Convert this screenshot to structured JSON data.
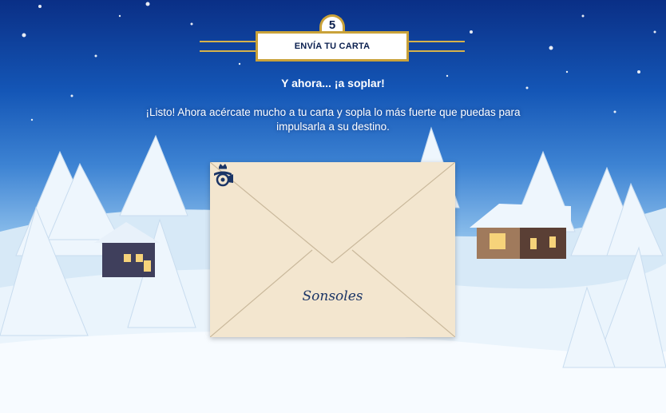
{
  "step": {
    "number": "5",
    "title": "ENVÍA TU CARTA"
  },
  "content": {
    "subtitle": "Y ahora... ¡a soplar!",
    "instructions": "¡Listo! Ahora acércate mucho a tu carta y sopla lo más fuerte que puedas para impulsarla a su destino."
  },
  "envelope": {
    "recipient": "Sonsoles",
    "logo": "correos-horn-icon"
  },
  "colors": {
    "gold": "#c9a23a",
    "navy": "#0a1f4f",
    "envelope": "#f3e6cf"
  }
}
